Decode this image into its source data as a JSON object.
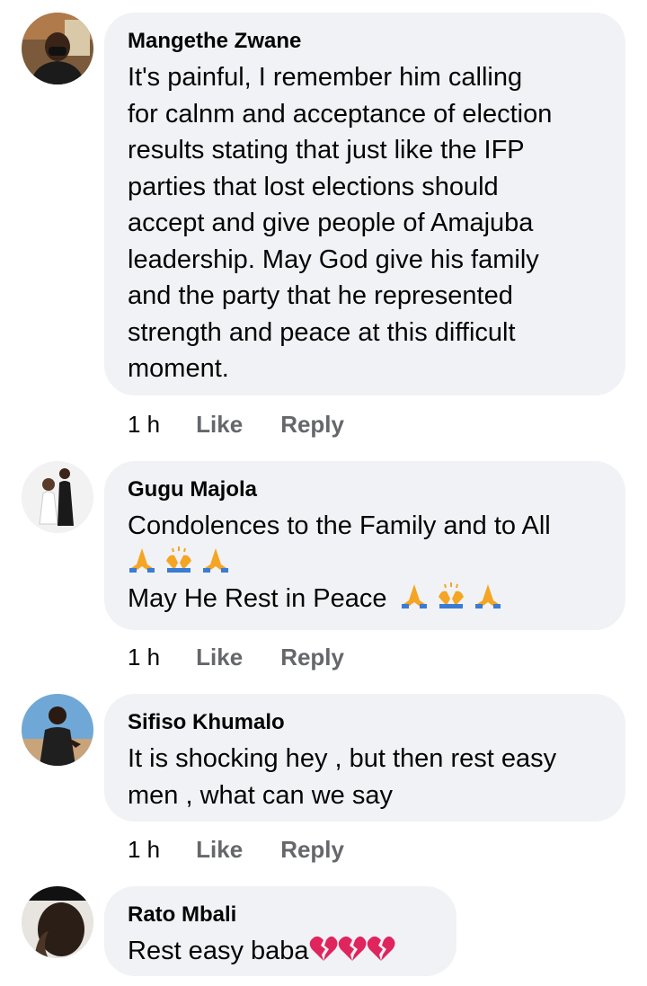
{
  "comments": [
    {
      "author": "Mangethe Zwane",
      "lines": [
        "It's painful, I remember him calling",
        "for calnm and acceptance of election",
        "results stating that just like the IFP",
        "parties that lost elections should",
        "accept and give people of Amajuba",
        "leadership.  May God give his family",
        "and the party that he represented",
        "strength and peace at this difficult",
        "moment."
      ],
      "time": "1 h",
      "like_label": "Like",
      "reply_label": "Reply"
    },
    {
      "author": "Gugu Majola",
      "lines": [
        "Condolences to the Family and to All",
        "",
        "May He Rest in Peace"
      ],
      "emojis": [
        "praying-hands",
        "raising-hands",
        "praying-hands"
      ],
      "time": "1 h",
      "like_label": "Like",
      "reply_label": "Reply"
    },
    {
      "author": "Sifiso Khumalo",
      "lines": [
        "It is shocking hey , but then rest easy",
        "men , what can we say"
      ],
      "time": "1 h",
      "like_label": "Like",
      "reply_label": "Reply"
    },
    {
      "author": "Rato Mbali",
      "lines": [
        "Rest easy baba"
      ],
      "emojis": [
        "broken-heart",
        "broken-heart",
        "broken-heart"
      ]
    }
  ],
  "colors": {
    "bubble": "#f0f2f5",
    "action_text": "#65676b",
    "broken_heart": "#e0245e",
    "praying_hands": "#f4a524",
    "sleeve": "#3a7bd5"
  }
}
